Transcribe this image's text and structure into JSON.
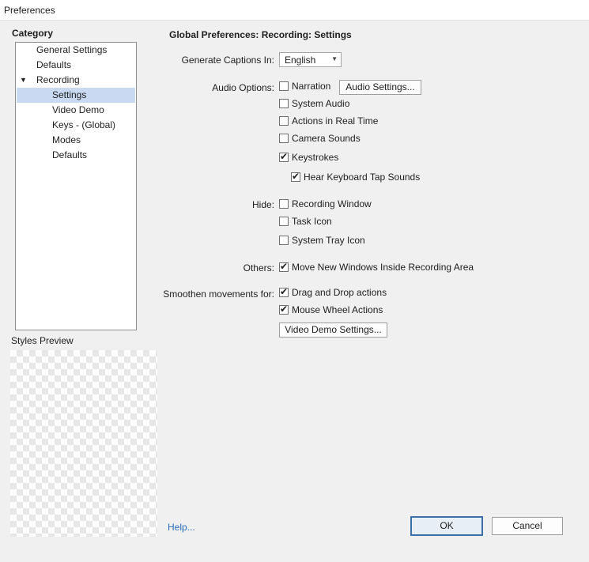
{
  "window": {
    "title": "Preferences"
  },
  "category": {
    "heading": "Category",
    "items": [
      {
        "label": "General Settings",
        "level": 0,
        "selected": false
      },
      {
        "label": "Defaults",
        "level": 0,
        "selected": false
      },
      {
        "label": "Recording",
        "level": 0,
        "expanded": true,
        "selected": false
      },
      {
        "label": "Settings",
        "level": 1,
        "selected": true
      },
      {
        "label": "Video Demo",
        "level": 1,
        "selected": false
      },
      {
        "label": "Keys - (Global)",
        "level": 1,
        "selected": false
      },
      {
        "label": "Modes",
        "level": 1,
        "selected": false
      },
      {
        "label": "Defaults",
        "level": 1,
        "selected": false
      }
    ],
    "expand_glyph": "▼"
  },
  "styles_preview": {
    "label": "Styles Preview"
  },
  "panel": {
    "title": "Global Preferences: Recording: Settings",
    "captions": {
      "label": "Generate Captions In:",
      "value": "English"
    },
    "audio": {
      "label": "Audio Options:",
      "narration": {
        "label": "Narration",
        "checked": false
      },
      "audio_settings_button": "Audio Settings...",
      "system_audio": {
        "label": "System Audio",
        "checked": false
      },
      "actions_real_time": {
        "label": "Actions in Real Time",
        "checked": false
      },
      "camera_sounds": {
        "label": "Camera Sounds",
        "checked": false
      },
      "keystrokes": {
        "label": "Keystrokes",
        "checked": true
      },
      "hear_keyboard": {
        "label": "Hear Keyboard Tap Sounds",
        "checked": true
      }
    },
    "hide": {
      "label": "Hide:",
      "recording_window": {
        "label": "Recording Window",
        "checked": false
      },
      "task_icon": {
        "label": "Task Icon",
        "checked": false
      },
      "system_tray_icon": {
        "label": "System Tray Icon",
        "checked": false
      }
    },
    "others": {
      "label": "Others:",
      "move_windows": {
        "label": "Move New Windows Inside Recording Area",
        "checked": true
      }
    },
    "smoothen": {
      "label": "Smoothen movements for:",
      "drag_drop": {
        "label": "Drag and Drop actions",
        "checked": true
      },
      "mouse_wheel": {
        "label": "Mouse Wheel Actions",
        "checked": true
      },
      "video_demo_button": "Video Demo Settings..."
    }
  },
  "footer": {
    "help": "Help...",
    "ok": "OK",
    "cancel": "Cancel"
  },
  "check_glyph": "✔"
}
